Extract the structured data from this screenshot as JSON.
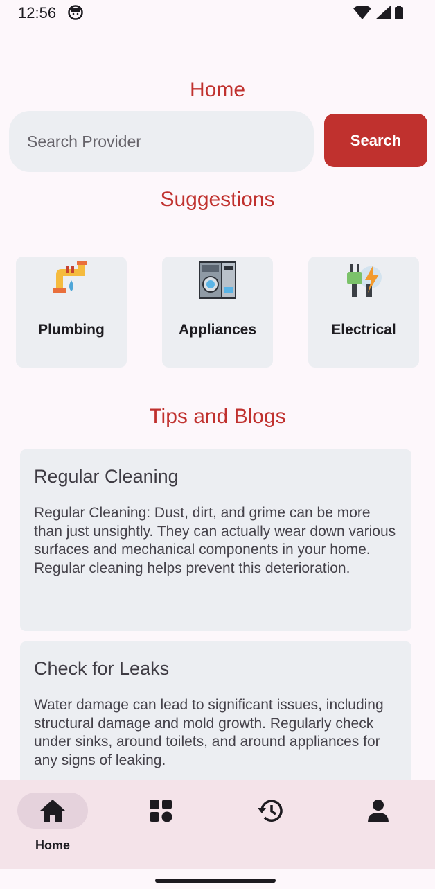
{
  "status_bar": {
    "time": "12:56"
  },
  "header": {
    "title": "Home"
  },
  "search": {
    "placeholder": "Search Provider",
    "button_label": "Search"
  },
  "suggestions": {
    "title": "Suggestions",
    "items": [
      {
        "label": "Plumbing",
        "icon": "plumbing-icon"
      },
      {
        "label": "Appliances",
        "icon": "appliances-icon"
      },
      {
        "label": "Electrical",
        "icon": "electrical-icon"
      }
    ]
  },
  "tips": {
    "title": "Tips and Blogs",
    "items": [
      {
        "title": "Regular Cleaning",
        "body": "Regular Cleaning: Dust, dirt, and grime can be more than just unsightly. They can actually wear down various surfaces and mechanical components in your home. Regular cleaning helps prevent this deterioration."
      },
      {
        "title": "Check for Leaks",
        "body": "Water damage can lead to significant issues, including structural damage and mold growth. Regularly check under sinks, around toilets, and around appliances for any signs of leaking."
      }
    ]
  },
  "bottom_nav": {
    "items": [
      {
        "label": "Home",
        "icon": "home-icon",
        "active": true
      },
      {
        "label": "",
        "icon": "categories-icon"
      },
      {
        "label": "",
        "icon": "history-icon"
      },
      {
        "label": "",
        "icon": "profile-icon"
      }
    ]
  },
  "colors": {
    "accent": "#c0312e",
    "background": "#fdf7fb",
    "card": "#eceef2",
    "nav_bg": "#f4e3e9"
  }
}
